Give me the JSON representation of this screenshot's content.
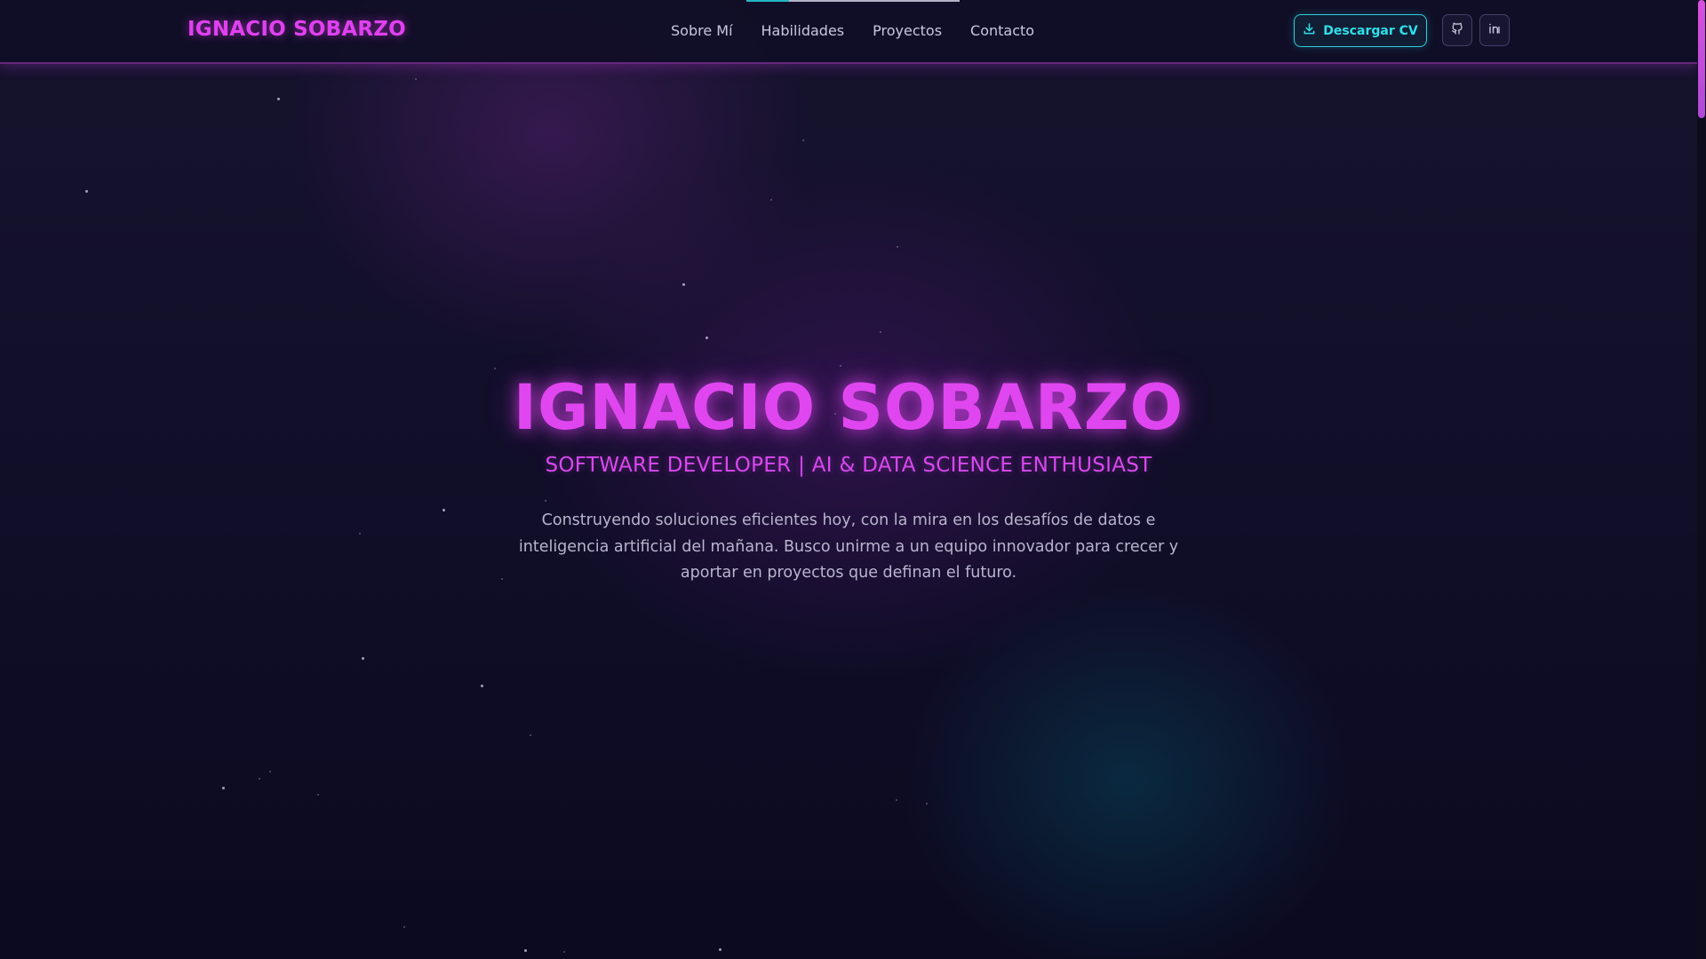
{
  "header": {
    "logo": "IGNACIO SOBARZO",
    "nav": [
      {
        "label": "Sobre Mí"
      },
      {
        "label": "Habilidades"
      },
      {
        "label": "Proyectos"
      },
      {
        "label": "Contacto"
      }
    ],
    "cv_button": "Descargar CV",
    "icons": [
      "download-icon",
      "github-icon",
      "linkedin-icon"
    ]
  },
  "hero": {
    "title": "IGNACIO SOBARZO",
    "subtitle": "SOFTWARE DEVELOPER | AI & DATA SCIENCE ENTHUSIAST",
    "description": "Construyendo soluciones eficientes hoy, con la mira en los desafíos de datos e inteligencia artificial del mañana. Busco unirme a un equipo innovador para crecer y aportar en proyectos que definan el futuro."
  },
  "colors": {
    "accent_magenta": "#e046f0",
    "accent_cyan": "#2ad0dc",
    "background": "#0b0a1e"
  }
}
